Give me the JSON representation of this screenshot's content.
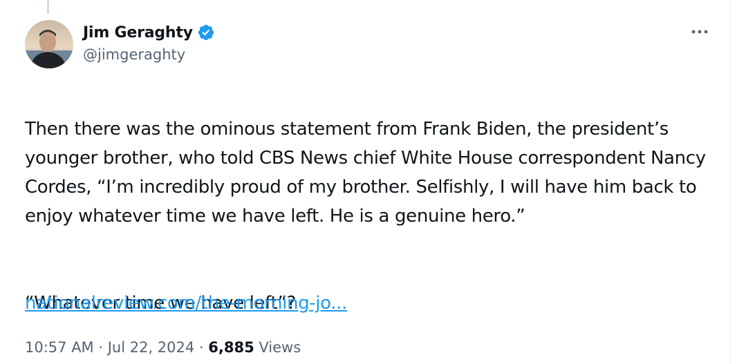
{
  "author": {
    "display_name": "Jim Geraghty",
    "handle": "@jimgeraghty",
    "verified_icon": "verified-badge-icon",
    "verified_color": "#1d9bf0"
  },
  "more_icon": "more-horizontal-icon",
  "tweet": {
    "paragraph_1": "Then there was the ominous statement from Frank Biden, the president’s younger brother, who told CBS News chief White House correspondent Nancy Cordes, “I’m incredibly proud of my brother. Selfishly, I will have him back to enjoy whatever time we have left. He is a genuine hero.”",
    "paragraph_2": "“Whatever time we have left”?",
    "link_text": "nationalreview.com/the-morning-jo..."
  },
  "meta": {
    "time": "10:57 AM",
    "separator_1": " · ",
    "date": "Jul 22, 2024",
    "separator_2": " · ",
    "views_count": "6,885",
    "views_label": " Views"
  },
  "colors": {
    "text": "#0f1419",
    "secondary": "#536471",
    "link": "#1d9bf0"
  }
}
